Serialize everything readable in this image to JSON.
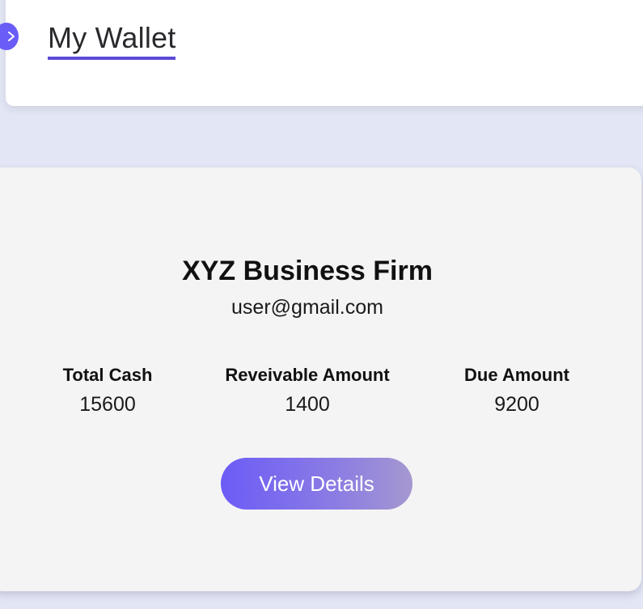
{
  "header": {
    "title": "My Wallet",
    "toggle_icon": "chevron-right-icon",
    "accent_color": "#5a4bd6"
  },
  "wallet": {
    "firm_name": "XYZ Business Firm",
    "email": "user@gmail.com",
    "stats": [
      {
        "label": "Total Cash",
        "value": "15600"
      },
      {
        "label": "Reveivable Amount",
        "value": "1400"
      },
      {
        "label": "Due Amount",
        "value": "9200"
      }
    ],
    "button_label": "View Details",
    "button_gradient": [
      "#6c5cf7",
      "#a598d0"
    ]
  }
}
